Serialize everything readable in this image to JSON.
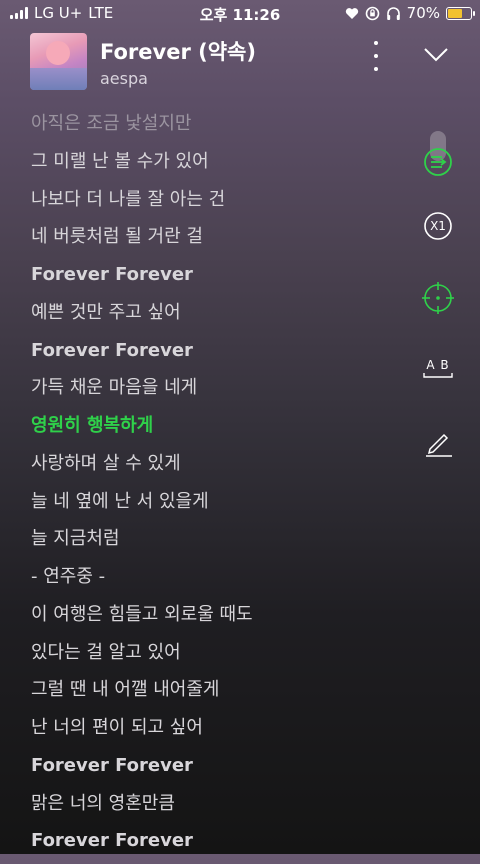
{
  "status_bar": {
    "carrier": "LG U+",
    "network": "LTE",
    "time": "오후 11:26",
    "battery_percent": "70%",
    "battery_level": 0.7
  },
  "header": {
    "title": "Forever (약속)",
    "artist": "aespa"
  },
  "lyrics": [
    {
      "text": "아직은 조금 낯설지만",
      "style": "faded"
    },
    {
      "text": "그 미랠 난 볼 수가 있어",
      "style": "normal"
    },
    {
      "text": "나보다 더 나를 잘 아는 건",
      "style": "normal"
    },
    {
      "text": "네 버릇처럼 될 거란 걸",
      "style": "normal"
    },
    {
      "text": "Forever Forever",
      "style": "bold"
    },
    {
      "text": "예쁜 것만 주고 싶어",
      "style": "normal"
    },
    {
      "text": "Forever Forever",
      "style": "bold"
    },
    {
      "text": "가득 채운 마음을 네게",
      "style": "normal"
    },
    {
      "text": "영원히 행복하게",
      "style": "current"
    },
    {
      "text": "사랑하며 살 수 있게",
      "style": "normal"
    },
    {
      "text": "늘 네 옆에 난 서 있을게",
      "style": "normal"
    },
    {
      "text": "늘 지금처럼",
      "style": "normal"
    },
    {
      "text": " - 연주중 -",
      "style": "normal"
    },
    {
      "text": "이 여행은 힘들고 외로울 때도",
      "style": "normal"
    },
    {
      "text": "있다는 걸 알고 있어",
      "style": "normal"
    },
    {
      "text": "그럴 땐 내 어깰 내어줄게",
      "style": "normal"
    },
    {
      "text": "난 너의 편이 되고 싶어",
      "style": "normal"
    },
    {
      "text": "Forever Forever",
      "style": "bold"
    },
    {
      "text": "맑은 너의 영혼만큼",
      "style": "normal"
    },
    {
      "text": "Forever Forever",
      "style": "bold"
    }
  ],
  "tools": {
    "speed_label": "X1",
    "ab_label": "A B"
  },
  "colors": {
    "accent": "#2fd14a",
    "battery": "#f2c230"
  }
}
